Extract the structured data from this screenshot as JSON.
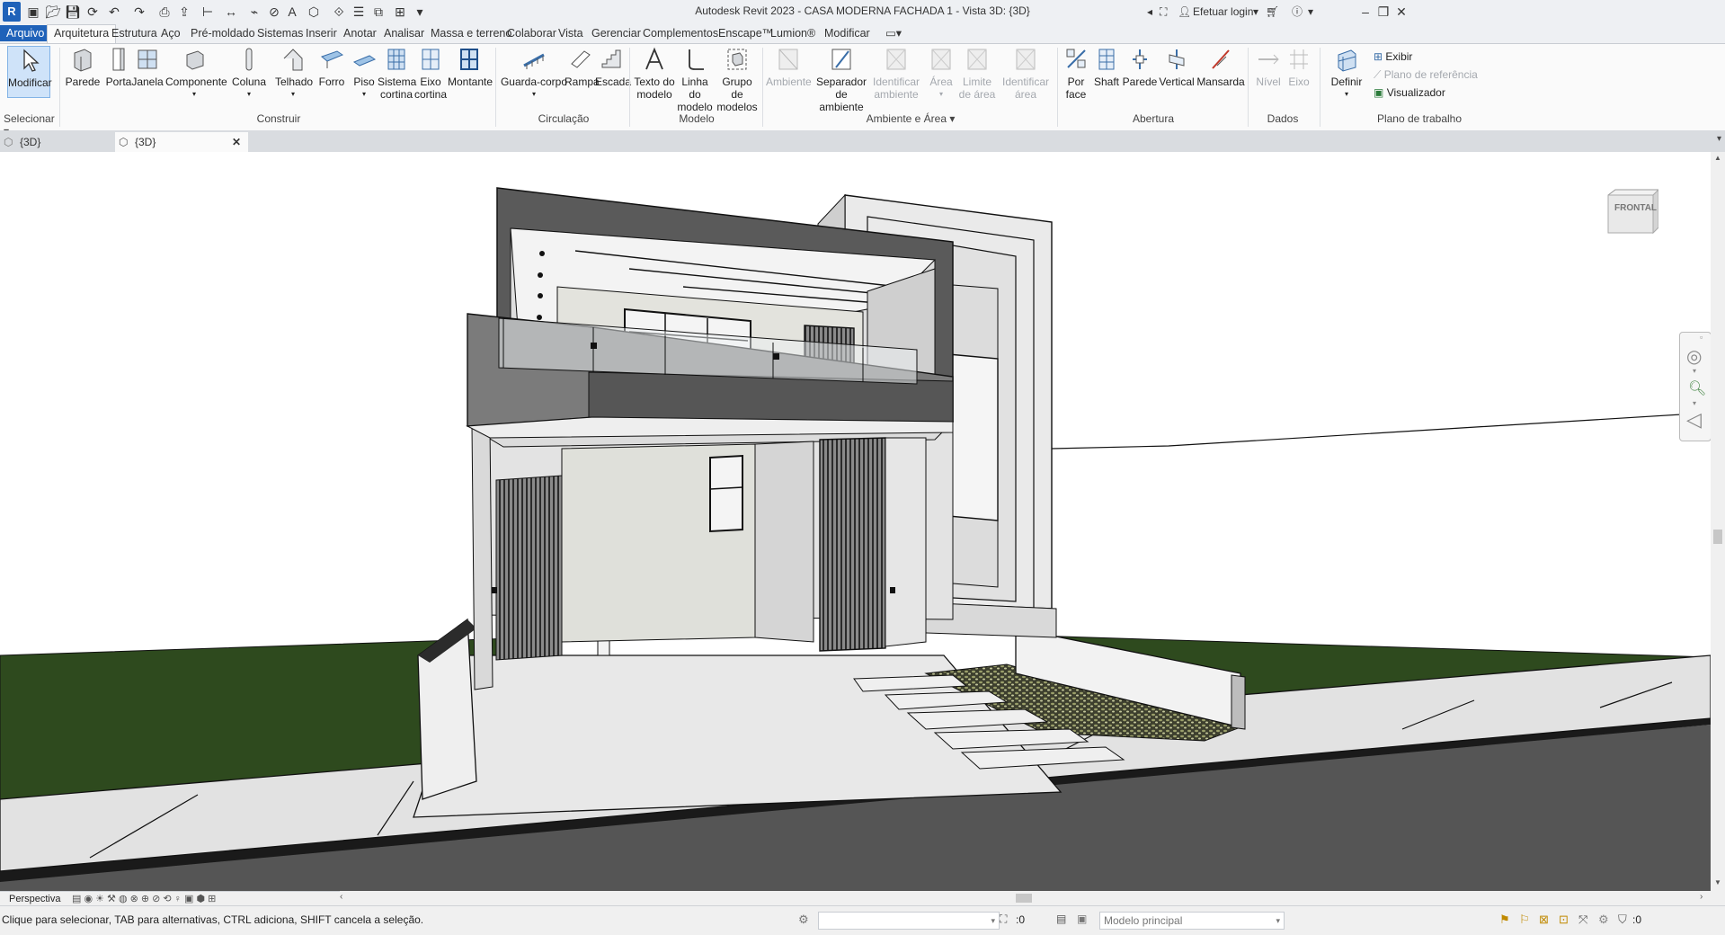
{
  "titlebar": {
    "logo": "R",
    "title": "Autodesk Revit 2023 - CASA MODERNA FACHADA 1 - Vista 3D: {3D}",
    "login": "Efetuar login"
  },
  "menu": {
    "file": "Arquivo",
    "tabs": [
      "Arquitetura",
      "Estrutura",
      "Aço",
      "Pré-moldado",
      "Sistemas",
      "Inserir",
      "Anotar",
      "Analisar",
      "Massa e terreno",
      "Colaborar",
      "Vista",
      "Gerenciar",
      "Complementos",
      "Enscape™",
      "Lumion®",
      "Modificar"
    ]
  },
  "ribbon": {
    "modify": "Modificar",
    "select_panel": "Selecionar",
    "build": {
      "title": "Construir",
      "wall": "Parede",
      "door": "Porta",
      "window": "Janela",
      "component": "Componente",
      "column": "Coluna",
      "roof": "Telhado",
      "ceiling": "Forro",
      "floor": "Piso",
      "curtain_system": [
        "Sistema",
        "cortina"
      ],
      "curtain_grid": [
        "Eixo",
        "cortina"
      ],
      "mullion": "Montante"
    },
    "circulation": {
      "title": "Circulação",
      "railing": "Guarda-corpo",
      "ramp": "Rampa",
      "stair": "Escada"
    },
    "model": {
      "title": "Modelo",
      "model_text": [
        "Texto do",
        "modelo"
      ],
      "model_line": [
        "Linha do",
        "modelo"
      ],
      "model_group": [
        "Grupo de",
        "modelos"
      ]
    },
    "room_area": {
      "title": "Ambiente e Área",
      "room": "Ambiente",
      "room_separator": [
        "Separador",
        "de ambiente"
      ],
      "tag_room": [
        "Identificar",
        "ambiente"
      ],
      "area": "Área",
      "area_boundary": [
        "Limite",
        "de área"
      ],
      "tag_area": [
        "Identificar",
        "área"
      ]
    },
    "opening": {
      "title": "Abertura",
      "by_face": [
        "Por",
        "face"
      ],
      "shaft": "Shaft",
      "wall": "Parede",
      "vertical": "Vertical",
      "dormer": "Mansarda"
    },
    "datum": {
      "title": "Dados",
      "level": "Nível",
      "grid": "Eixo"
    },
    "work_plane": {
      "title": "Plano de trabalho",
      "set": "Definir",
      "show": "Exibir",
      "ref_plane": "Plano de referência",
      "viewer": "Visualizador"
    }
  },
  "view_tabs": [
    {
      "label": "{3D}"
    },
    {
      "label": "{3D}"
    }
  ],
  "viewcube": {
    "face": "FRONTAL"
  },
  "view_control": {
    "mode": "Perspectiva"
  },
  "status": {
    "hint": "Clique para selecionar, TAB para alternativas, CTRL adiciona, SHIFT cancela a seleção.",
    "workset_value": ":0",
    "design_option": "Modelo principal",
    "filter_count": ":0"
  },
  "colors": {
    "accent": "#1f62b9",
    "grass": "#2e4a1e",
    "road": "#555555",
    "dark_band": "#5a5a5a"
  }
}
